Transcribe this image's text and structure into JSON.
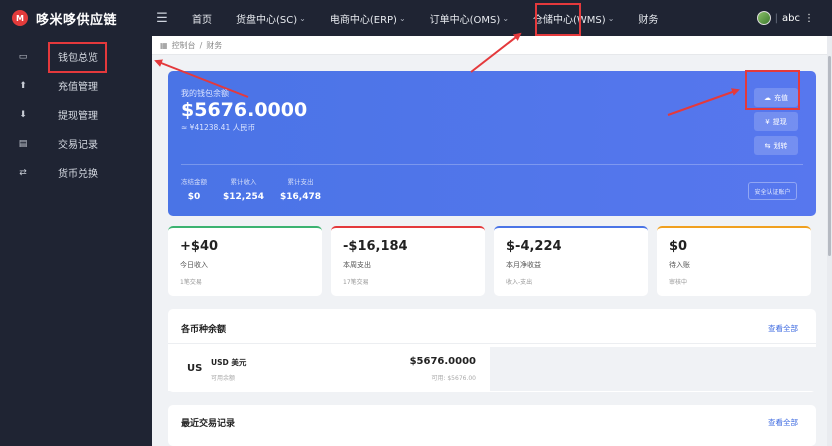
{
  "brand": {
    "name": "哆米哆供应链",
    "logo_text": "M"
  },
  "topnav": {
    "items": [
      {
        "label": "首页",
        "has_caret": false
      },
      {
        "label": "货盘中心(SC)",
        "has_caret": true
      },
      {
        "label": "电商中心(ERP)",
        "has_caret": true
      },
      {
        "label": "订单中心(OMS)",
        "has_caret": true
      },
      {
        "label": "仓储中心(WMS)",
        "has_caret": true
      },
      {
        "label": "财务",
        "has_caret": false,
        "active": true
      }
    ],
    "user": "abc"
  },
  "sidebar": {
    "items": [
      {
        "label": "钱包总览",
        "icon": "card-icon"
      },
      {
        "label": "充值管理",
        "icon": "upload-icon"
      },
      {
        "label": "提现管理",
        "icon": "download-icon"
      },
      {
        "label": "交易记录",
        "icon": "list-icon"
      },
      {
        "label": "货币兑换",
        "icon": "exchange-icon"
      }
    ]
  },
  "breadcrumb": {
    "home": "控制台",
    "sep": "/",
    "current": "财务"
  },
  "wallet": {
    "label": "我的钱包余额",
    "balance": "$5676.0000",
    "cny": "≈ ¥41238.41 人民币",
    "stats": [
      {
        "label": "冻结金额",
        "value": "$0"
      },
      {
        "label": "累计收入",
        "value": "$12,254"
      },
      {
        "label": "累计支出",
        "value": "$16,478"
      }
    ],
    "buttons": {
      "recharge": "充值",
      "withdraw": "提现",
      "transfer": "划转"
    },
    "secure": "安全认证账户"
  },
  "stat_cards": [
    {
      "value": "+$40",
      "label": "今日收入",
      "sub": "1笔交易",
      "color": "#3cb371"
    },
    {
      "value": "-$16,184",
      "label": "本周支出",
      "sub": "17笔交易",
      "color": "#e4393c"
    },
    {
      "value": "$-4,224",
      "label": "本月净收益",
      "sub": "收入-支出",
      "color": "#4a74e6"
    },
    {
      "value": "$0",
      "label": "待入账",
      "sub": "审核中",
      "color": "#f0a020"
    }
  ],
  "currency_panel": {
    "title": "各币种余额",
    "link": "查看全部",
    "row": {
      "code": "US",
      "name": "USD 美元",
      "sub": "可用余额",
      "amount": "$5676.0000",
      "available": "可用: $5676.00"
    }
  },
  "recent_panel": {
    "title": "最近交易记录",
    "link": "查看全部"
  },
  "colors": {
    "sidebar_bg": "#1f2433",
    "wallet_bg": "#4a74e6",
    "annotation": "#e4393c",
    "link": "#3d6ae0"
  }
}
